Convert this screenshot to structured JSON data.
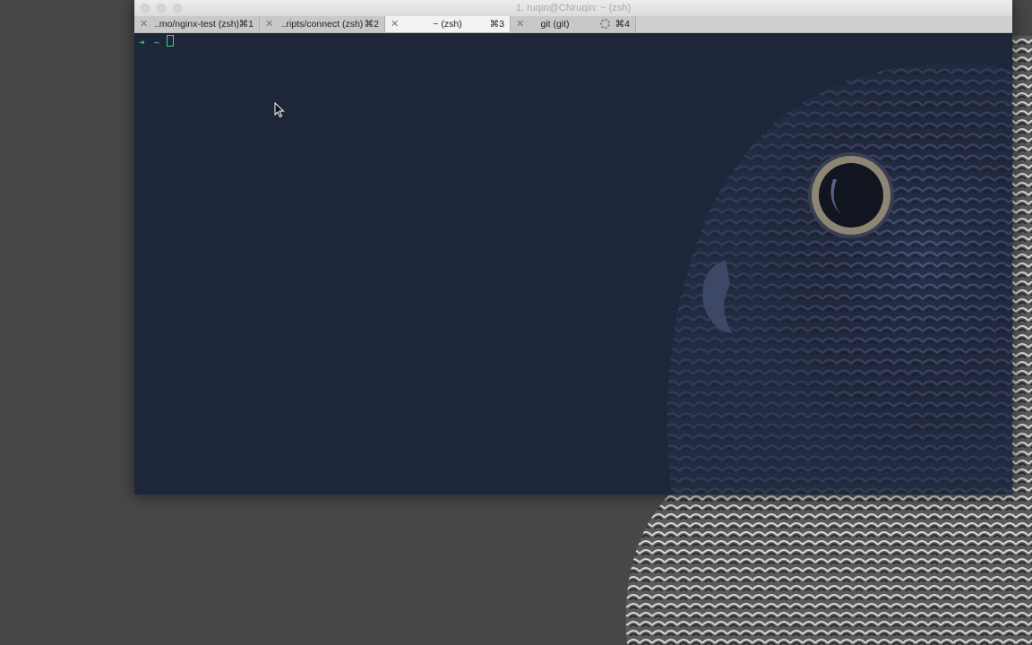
{
  "window": {
    "title": "1. ruqin@CNruqin: ~ (zsh)"
  },
  "tabs": [
    {
      "close": "✕",
      "label": "..mo/nginx-test (zsh)",
      "shortcut": "⌘1",
      "active": false
    },
    {
      "close": "✕",
      "label": "..ripts/connect (zsh)",
      "shortcut": "⌘2",
      "active": false
    },
    {
      "close": "✕",
      "label": "~ (zsh)",
      "shortcut": "⌘3",
      "active": true
    },
    {
      "close": "✕",
      "label": "git (git)",
      "shortcut": "⌘4",
      "active": false,
      "busy": true
    }
  ],
  "terminal": {
    "prompt_arrow": "➜",
    "prompt_dir": "~",
    "background": "#1e2639",
    "prompt_color": "#46c36b",
    "dir_color": "#5fb3c9"
  },
  "icons": {
    "mouse": "mouse-pointer-icon",
    "wallpaper": "owl-wallpaper"
  }
}
